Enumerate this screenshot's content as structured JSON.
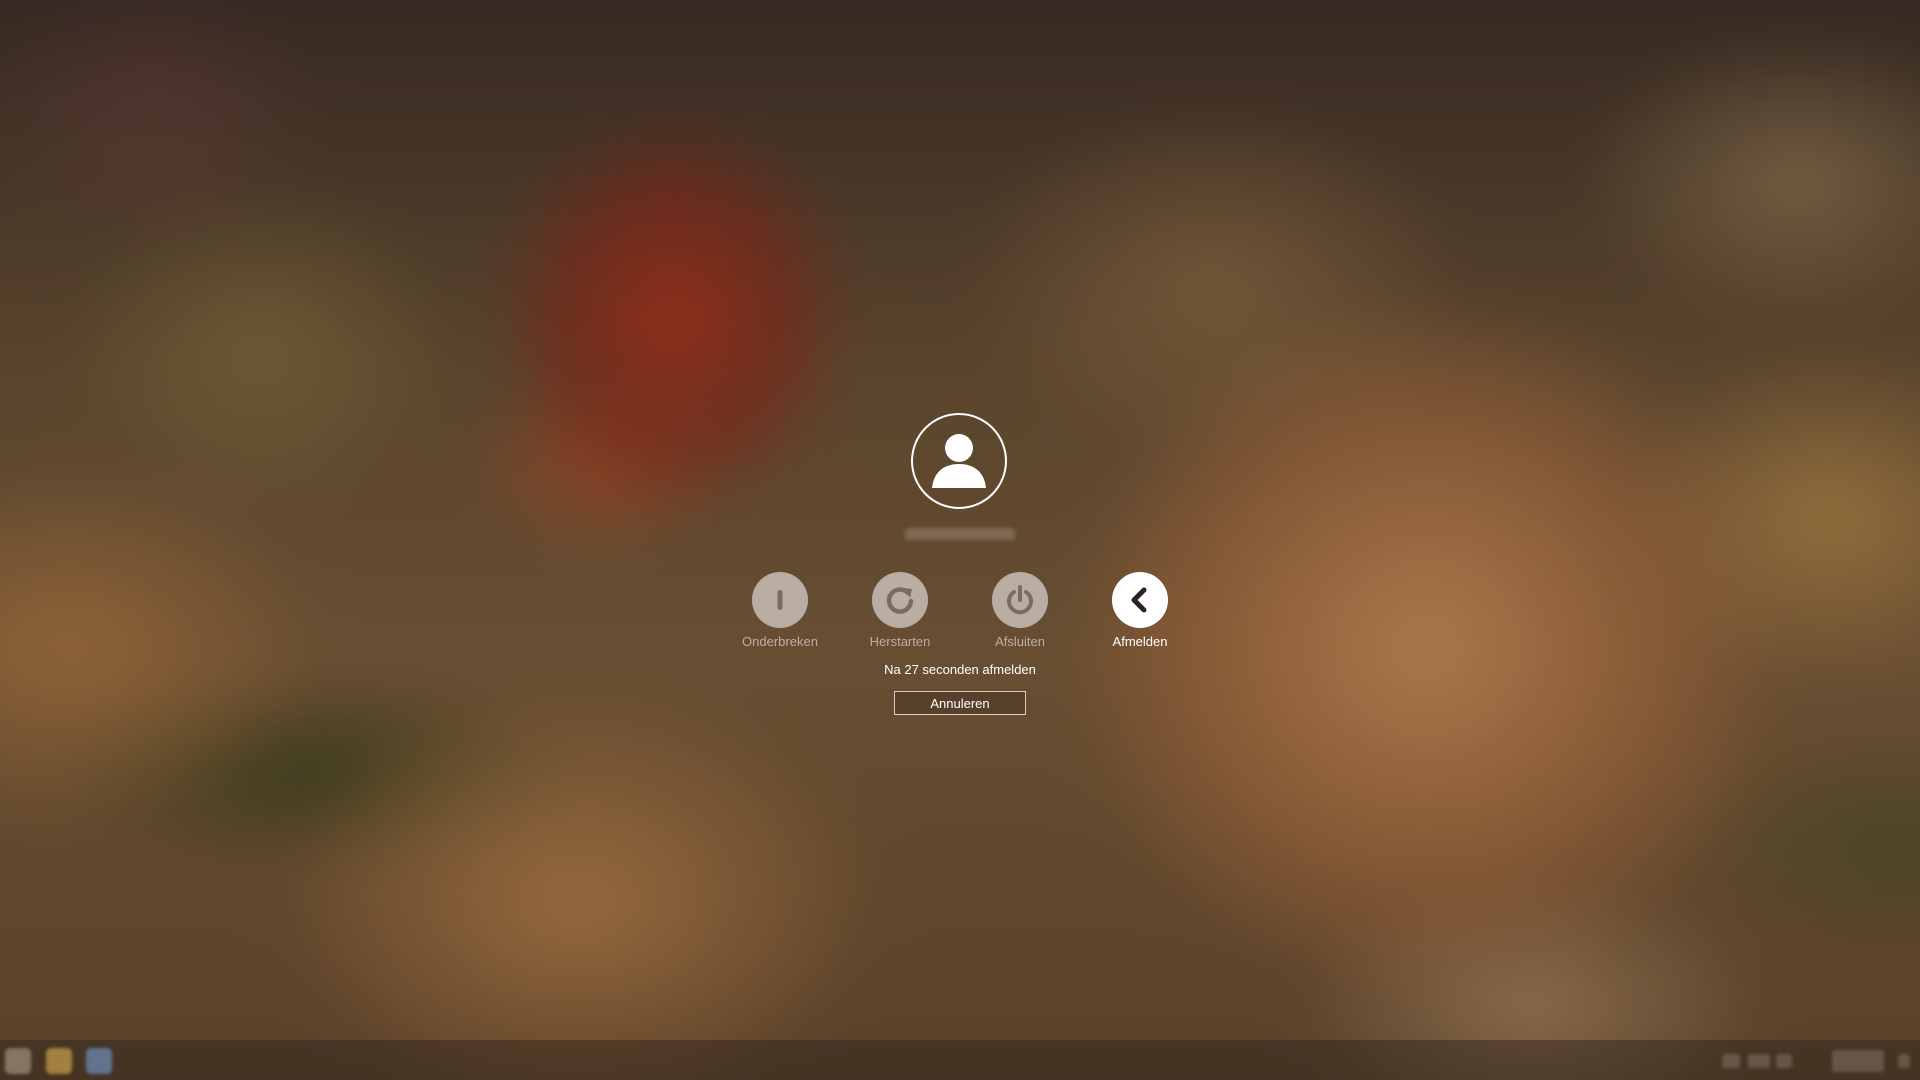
{
  "dialog": {
    "user_name": "",
    "actions": [
      {
        "label": "Onderbreken",
        "icon": "suspend-icon",
        "active": false
      },
      {
        "label": "Herstarten",
        "icon": "restart-icon",
        "active": false
      },
      {
        "label": "Afsluiten",
        "icon": "power-icon",
        "active": false
      },
      {
        "label": "Afmelden",
        "icon": "logout-arrow-icon",
        "active": true
      }
    ],
    "countdown_text": "Na 27 seconden afmelden",
    "cancel_label": "Annuleren"
  },
  "taskbar": {
    "launchers": [
      "menu-icon",
      "files-icon",
      "browser-icon"
    ],
    "clock": ""
  },
  "colors": {
    "active_button": "#ffffff",
    "inactive_button": "rgba(255,255,255,0.55)",
    "text": "#ffffff"
  }
}
